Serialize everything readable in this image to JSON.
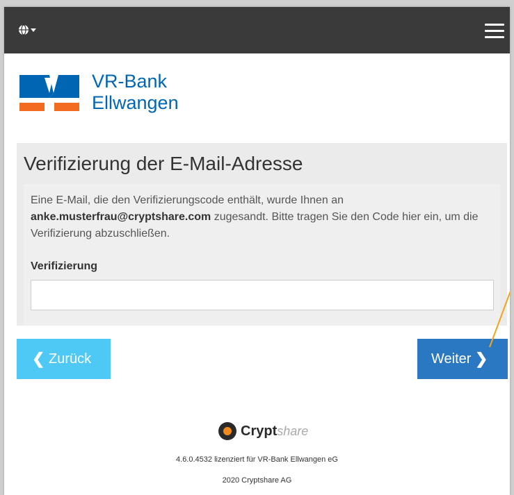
{
  "header": {
    "language_icon": "globe-icon",
    "menu_icon": "hamburger-menu-icon"
  },
  "logo": {
    "line1": "VR-Bank",
    "line2": "Ellwangen",
    "colors": {
      "blue": "#0066b3",
      "orange": "#f26b21"
    }
  },
  "panel": {
    "title": "Verifizierung der E-Mail-Adresse",
    "text_before": "Eine E-Mail, die den Verifizierungscode enthält, wurde Ihnen an ",
    "email": "anke.musterfrau@cryptshare.com",
    "text_after": " zugesandt. Bitte tragen Sie den Code hier ein, um die Verifizierung abzuschließen.",
    "field_label": "Verifizierung",
    "field_value": "",
    "field_placeholder": ""
  },
  "buttons": {
    "back_chevron": "❮",
    "back_label": "Zurück",
    "next_label": "Weiter",
    "next_chevron": "❯",
    "back_color": "#4ec8f5",
    "next_color": "#2b78c2"
  },
  "footer": {
    "brand_bold": "Crypt",
    "brand_light": "share",
    "version_line": "4.6.0.4532 lizenziert für VR-Bank Ellwangen eG",
    "copyright_line": "2020 Cryptshare AG"
  }
}
